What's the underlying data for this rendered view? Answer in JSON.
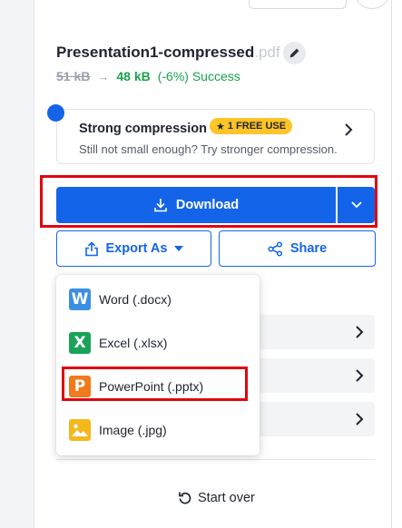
{
  "file": {
    "name": "Presentation1-compressed",
    "extension": ".pdf",
    "size_before": "51 kB",
    "arrow": "→",
    "size_after": "48 kB",
    "result": "(-6%) Success"
  },
  "upsell": {
    "title": "Strong compression",
    "badge": "1 FREE USE",
    "subtitle": "Still not small enough? Try stronger compression."
  },
  "actions": {
    "download_label": "Download",
    "export_label": "Export As",
    "share_label": "Share"
  },
  "export_menu": {
    "items": [
      {
        "label": "Word (.docx)",
        "icon": "word-icon",
        "letter": "W",
        "color": "#3b8fe3"
      },
      {
        "label": "Excel (.xlsx)",
        "icon": "excel-icon",
        "letter": "X",
        "color": "#1aa358"
      },
      {
        "label": "PowerPoint (.pptx)",
        "icon": "powerpoint-icon",
        "letter": "P",
        "color": "#f07a1c"
      },
      {
        "label": "Image (.jpg)",
        "icon": "image-icon",
        "letter": "",
        "color": "#f5b81c"
      }
    ]
  },
  "footer": {
    "start_over_label": "Start over"
  },
  "colors": {
    "primary": "#1464ea",
    "success": "#18a34a",
    "badge": "#ffc425",
    "highlight": "#e0060f"
  }
}
